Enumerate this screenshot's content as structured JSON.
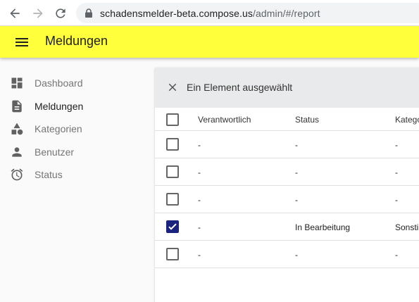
{
  "browser": {
    "url_domain": "schadensmelder-beta.compose.us",
    "url_path": "/admin/#/report"
  },
  "appbar": {
    "title": "Meldungen"
  },
  "sidebar": {
    "items": [
      {
        "label": "Dashboard",
        "icon": "dashboard-icon",
        "active": false
      },
      {
        "label": "Meldungen",
        "icon": "document-icon",
        "active": true
      },
      {
        "label": "Kategorien",
        "icon": "category-icon",
        "active": false
      },
      {
        "label": "Benutzer",
        "icon": "person-icon",
        "active": false
      },
      {
        "label": "Status",
        "icon": "alarm-icon",
        "active": false
      }
    ]
  },
  "bulk": {
    "text": "Ein Element ausgewählt"
  },
  "table": {
    "columns": [
      "Verantwortlich",
      "Status",
      "Katego"
    ],
    "rows": [
      {
        "checked": false,
        "cells": [
          "-",
          "-",
          "-"
        ]
      },
      {
        "checked": false,
        "cells": [
          "-",
          "-",
          "-"
        ]
      },
      {
        "checked": false,
        "cells": [
          "-",
          "-",
          "-"
        ]
      },
      {
        "checked": true,
        "cells": [
          "-",
          "In Bearbeitung",
          "Sonsti"
        ]
      },
      {
        "checked": false,
        "cells": [
          "-",
          "-",
          "-"
        ]
      }
    ]
  },
  "colors": {
    "appbar": "#ffff3b",
    "checkbox_checked": "#1a237e"
  }
}
